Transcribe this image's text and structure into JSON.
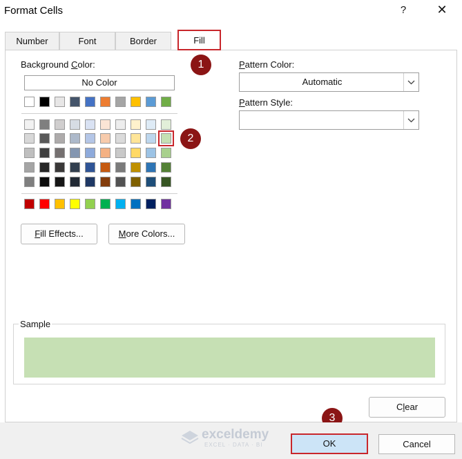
{
  "window": {
    "title": "Format Cells",
    "help_glyph": "?",
    "close_glyph": "✕"
  },
  "tabs": [
    {
      "label": "Number"
    },
    {
      "label": "Font"
    },
    {
      "label": "Border"
    },
    {
      "label": "Fill",
      "selected": true
    }
  ],
  "markers": {
    "step1": "1",
    "step2": "2",
    "step3": "3",
    "color": "#8b1515"
  },
  "fill": {
    "background_color": {
      "label_pre": "Background ",
      "label_ul": "C",
      "label_post": "olor:"
    },
    "no_color_label": "No Color",
    "palette": {
      "row_standard": [
        "#ffffff",
        "#000000",
        "#e7e6e6",
        "#44546a",
        "#4472c4",
        "#ed7d31",
        "#a5a5a5",
        "#ffc000",
        "#5b9bd5",
        "#70ad47"
      ],
      "theme_rows": [
        [
          "#f2f2f2",
          "#7f7f7f",
          "#d0cece",
          "#d6dce4",
          "#d9e2f3",
          "#fbe5d5",
          "#ededed",
          "#fff2cc",
          "#deebf6",
          "#e2efd9"
        ],
        [
          "#d8d8d8",
          "#595959",
          "#aeabab",
          "#adb9ca",
          "#b4c6e7",
          "#f7cbac",
          "#dbdbdb",
          "#fee599",
          "#bdd7ee",
          "#c5e0b3"
        ],
        [
          "#bfbfbf",
          "#3f3f3f",
          "#757070",
          "#8496b0",
          "#8eaadb",
          "#f4b183",
          "#c9c9c9",
          "#ffd965",
          "#9cc3e5",
          "#a8d08d"
        ],
        [
          "#a5a5a5",
          "#262626",
          "#3a3838",
          "#323f4f",
          "#2f5496",
          "#c55a11",
          "#7b7b7b",
          "#bf9000",
          "#2e75b5",
          "#538135"
        ],
        [
          "#7f7f7f",
          "#0c0c0c",
          "#161616",
          "#222a35",
          "#1f3864",
          "#833c0b",
          "#525252",
          "#7f6000",
          "#1e4e79",
          "#375623"
        ]
      ],
      "standard_colors": [
        "#c00000",
        "#ff0000",
        "#ffc000",
        "#ffff00",
        "#92d050",
        "#00b050",
        "#00b0f0",
        "#0070c0",
        "#002060",
        "#7030a0"
      ],
      "selected_color": "#c5e0b3"
    },
    "fill_effects": {
      "ul": "F",
      "rest": "ill Effects..."
    },
    "more_colors": {
      "ul": "M",
      "rest": "ore Colors..."
    },
    "pattern_color": {
      "label_ul": "P",
      "label_rest": "attern Color:",
      "value": "Automatic"
    },
    "pattern_style": {
      "label_ul": "P",
      "label_rest": "attern Style:",
      "value": ""
    },
    "sample": {
      "label": "Sample",
      "color": "#c6e0b4"
    },
    "clear": {
      "pre": "C",
      "ul": "l",
      "post": "ear"
    }
  },
  "buttons": {
    "ok": "OK",
    "cancel": "Cancel"
  },
  "watermark": {
    "name": "exceldemy",
    "tagline": "EXCEL · DATA · BI"
  }
}
